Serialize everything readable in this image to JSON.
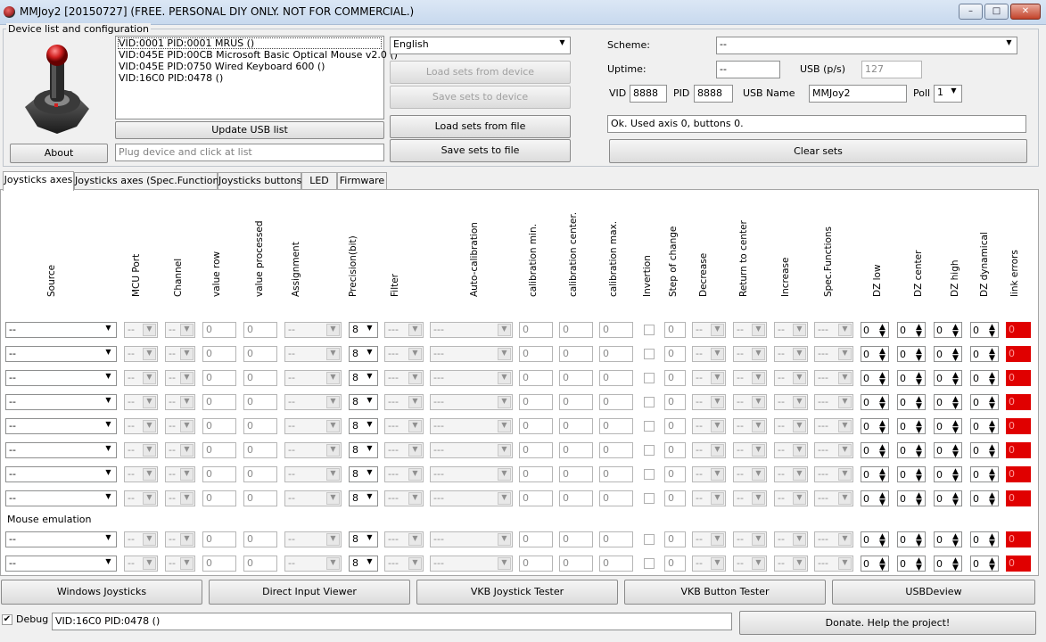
{
  "window": {
    "title": "MMJoy2 [20150727] (FREE. PERSONAL DIY ONLY. NOT FOR COMMERCIAL.)",
    "min": "–",
    "max": "□",
    "close": "✕"
  },
  "device": {
    "group_label": "Device list and configuration",
    "list": [
      "VID:0001 PID:0001 MRUS ()",
      "VID:045E PID:00CB Microsoft Basic Optical Mouse v2.0  ()",
      "VID:045E PID:0750 Wired Keyboard 600 ()",
      "VID:16C0 PID:0478  ()"
    ],
    "update_label": "Update USB list",
    "about_label": "About",
    "hint_placeholder": "Plug device and click at list"
  },
  "middle": {
    "language": "English",
    "load_device": "Load sets from device",
    "save_device": "Save sets to device",
    "load_file": "Load sets from file",
    "save_file": "Save sets to file"
  },
  "right": {
    "scheme_label": "Scheme:",
    "scheme_value": "--",
    "uptime_label": "Uptime:",
    "uptime_value": "--",
    "usb_ps_label": "USB (p/s)",
    "usb_ps_value": "127",
    "vid_label": "VID",
    "vid_value": "8888",
    "pid_label": "PID",
    "pid_value": "8888",
    "usbname_label": "USB Name",
    "usbname_value": "MMJoy2",
    "poll_label": "Poll",
    "poll_value": "1",
    "status": "Ok. Used axis  0, buttons 0.",
    "clear_label": "Clear sets"
  },
  "tabs": [
    "Joysticks axes",
    "Joysticks axes (Spec.Functions)",
    "Joysticks buttons",
    "LED",
    "Firmware"
  ],
  "columns": [
    "Source",
    "MCU Port",
    "Channel",
    "value row",
    "value processed",
    "Assignment",
    "Precision(bit)",
    "Filter",
    "Auto-calibration",
    "calibration min.",
    "calibration center.",
    "calibration max.",
    "Invertion",
    "Step of change",
    "Decrease",
    "Return to center",
    "Increase",
    "Spec.Functions",
    "DZ low",
    "DZ center",
    "DZ high",
    "DZ dynamical",
    "link errors"
  ],
  "row_values": {
    "source": "--",
    "dash": "--",
    "dash3": "---",
    "zero": "0",
    "precision": "8",
    "err": "0"
  },
  "mouse_label": "Mouse emulation",
  "bottom": [
    "Windows Joysticks",
    "Direct Input Viewer",
    "VKB Joystick Tester",
    "VKB Button Tester",
    "USBDeview"
  ],
  "debug": {
    "label": "Debug",
    "checked": true,
    "value": "VID:16C0 PID:0478  ()",
    "donate": "Donate. Help the project!"
  },
  "colors": {
    "error_red": "#e00000",
    "titlebar": "#c8d9ee"
  }
}
